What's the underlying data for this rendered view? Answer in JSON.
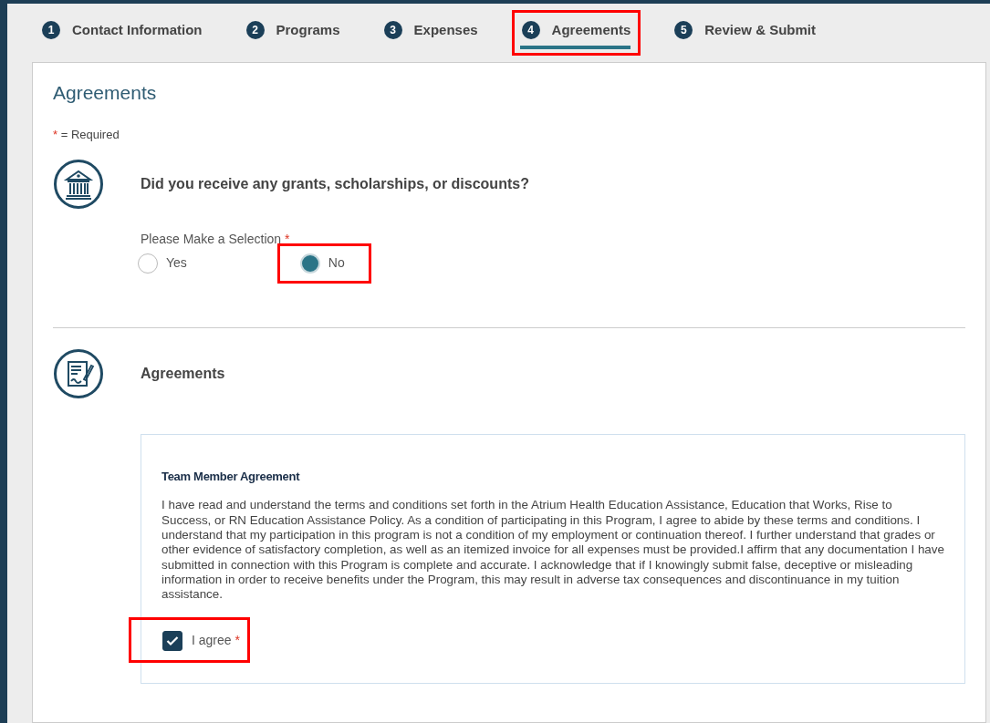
{
  "steps": [
    {
      "number": "1",
      "label": "Contact Information",
      "selected": false,
      "highlighted": false
    },
    {
      "number": "2",
      "label": "Programs",
      "selected": false,
      "highlighted": false
    },
    {
      "number": "3",
      "label": "Expenses",
      "selected": false,
      "highlighted": false
    },
    {
      "number": "4",
      "label": "Agreements",
      "selected": true,
      "highlighted": true
    },
    {
      "number": "5",
      "label": "Review & Submit",
      "selected": false,
      "highlighted": false
    }
  ],
  "page_title": "Agreements",
  "required_note": {
    "mark": "*",
    "text": "= Required"
  },
  "sections": [
    {
      "kind": "question",
      "title": "Did you receive any grants, scholarships, or discounts?",
      "prompt": "Please Make a Selection",
      "required": true,
      "options": [
        {
          "label": "Yes",
          "selected": false,
          "highlighted": false
        },
        {
          "label": "No",
          "selected": true,
          "highlighted": true
        }
      ]
    },
    {
      "kind": "agreement",
      "title": "Agreements",
      "box_title": "Team Member Agreement",
      "text": "I have read and understand the terms and conditions set forth in the Atrium Health Education Assistance, Education that Works, Rise to Success, or RN Education Assistance Policy. As a condition of participating in this Program, I agree to abide by these terms and conditions. I understand that my participation in this program is not a condition of my employment or continuation thereof. I further understand that grades or other evidence of satisfactory completion, as well as an itemized invoice for all expenses must be provided.I affirm that any documentation I have submitted in connection with this Program is complete and accurate. I acknowledge that if I knowingly submit false, deceptive or misleading information in order to receive benefits under the Program, this may result in adverse tax consequences and discontinuance in my tuition assistance.",
      "checkbox": {
        "label": "I agree",
        "checked": true,
        "required": true,
        "highlighted": true
      }
    }
  ]
}
